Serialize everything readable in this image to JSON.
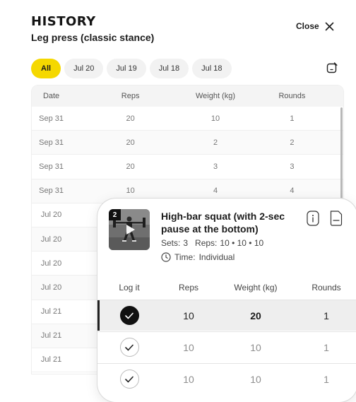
{
  "history": {
    "title": "HISTORY",
    "subtitle": "Leg press (classic stance)",
    "close_label": "Close",
    "chips": [
      "All",
      "Jul 20",
      "Jul 19",
      "Jul 18",
      "Jul 18"
    ],
    "active_chip": "All",
    "columns": [
      "Date",
      "Reps",
      "Weight  (kg)",
      "Rounds"
    ],
    "rows": [
      [
        "Sep 31",
        "20",
        "10",
        "1"
      ],
      [
        "Sep 31",
        "20",
        "2",
        "2"
      ],
      [
        "Sep 31",
        "20",
        "3",
        "3"
      ],
      [
        "Sep 31",
        "10",
        "4",
        "4"
      ],
      [
        "Jul 20",
        "",
        "",
        ""
      ],
      [
        "Jul 20",
        "",
        "",
        ""
      ],
      [
        "Jul 20",
        "",
        "",
        ""
      ],
      [
        "Jul 20",
        "",
        "",
        ""
      ],
      [
        "Jul 21",
        "",
        "",
        ""
      ],
      [
        "Jul 21",
        "",
        "",
        ""
      ],
      [
        "Jul 21",
        "",
        "",
        ""
      ]
    ]
  },
  "exercise": {
    "badge": "2",
    "title": "High-bar squat (with 2-sec pause at the bottom)",
    "sets_label": "Sets:",
    "sets_value": "3",
    "reps_label": "Reps:",
    "reps_value": "10 • 10 • 10",
    "time_label": "Time:",
    "time_value": "Individual",
    "columns": [
      "Log it",
      "Reps",
      "Weight  (kg)",
      "Rounds"
    ],
    "rows": [
      {
        "reps": "10",
        "weight": "20",
        "rounds": "1",
        "done": true
      },
      {
        "reps": "10",
        "weight": "10",
        "rounds": "1",
        "done": false
      },
      {
        "reps": "10",
        "weight": "10",
        "rounds": "1",
        "done": false
      }
    ]
  },
  "icons": {
    "close": "close-icon",
    "note": "note-edit-icon",
    "info": "info-icon",
    "document": "document-icon",
    "clock": "clock-icon",
    "check": "check-icon",
    "play": "play-icon"
  },
  "colors": {
    "accent": "#f5d800",
    "done_check": "#111111"
  }
}
